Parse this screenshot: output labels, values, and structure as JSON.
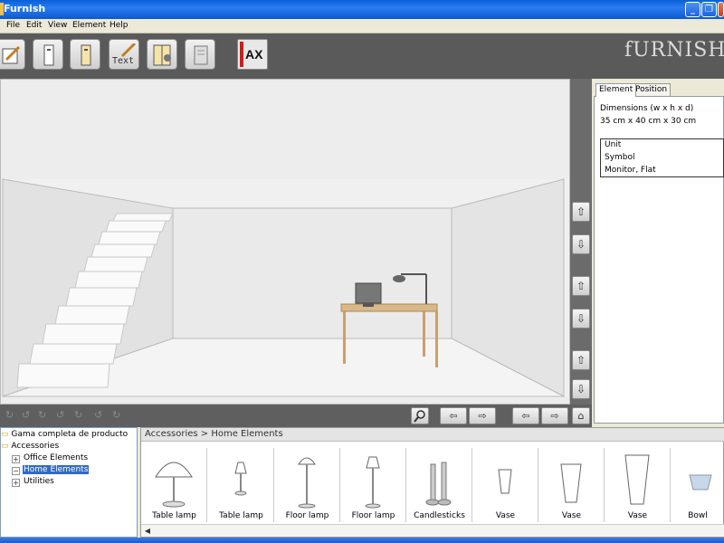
{
  "window": {
    "title": "Furnish",
    "minimize": "_",
    "maximize": "❐",
    "close": "✕"
  },
  "menu": [
    "File",
    "Edit",
    "View",
    "Element",
    "Help"
  ],
  "toolbar": {
    "text_button": "Text",
    "ax_button": "AX",
    "logo": "FURNISH"
  },
  "nav": {
    "up": "⇧",
    "down": "⇩",
    "arrow_up": "⇧",
    "arrow_down": "⇩",
    "left": "⇦",
    "right": "⇨",
    "home": "⌂",
    "zoom": "🔍"
  },
  "properties": {
    "tabs": [
      "Element",
      "Position"
    ],
    "active_tab": "Element",
    "dimensions_label": "Dimensions (w x h x d)",
    "dimensions_value": "35 cm x 40 cm x 30 cm",
    "info_rows": [
      "Unit",
      "Symbol",
      "Monitor, Flat"
    ]
  },
  "tree": {
    "root": "Gama completa de producto",
    "accessories": "Accessories",
    "children": [
      "Office Elements",
      "Home Elements",
      "Utilities"
    ],
    "selected": "Home Elements"
  },
  "catalog": {
    "breadcrumb": "Accessories > Home Elements",
    "items": [
      {
        "label": "Table lamp",
        "icon": "table-lamp-dome-icon"
      },
      {
        "label": "Table lamp",
        "icon": "table-lamp-small-icon"
      },
      {
        "label": "Floor lamp",
        "icon": "floor-lamp-icon"
      },
      {
        "label": "Floor lamp",
        "icon": "floor-lamp-tall-icon"
      },
      {
        "label": "Candlesticks",
        "icon": "candlesticks-icon"
      },
      {
        "label": "Vase",
        "icon": "vase-small-icon"
      },
      {
        "label": "Vase",
        "icon": "vase-medium-icon"
      },
      {
        "label": "Vase",
        "icon": "vase-tall-icon"
      },
      {
        "label": "Bowl",
        "icon": "bowl-icon"
      }
    ]
  }
}
